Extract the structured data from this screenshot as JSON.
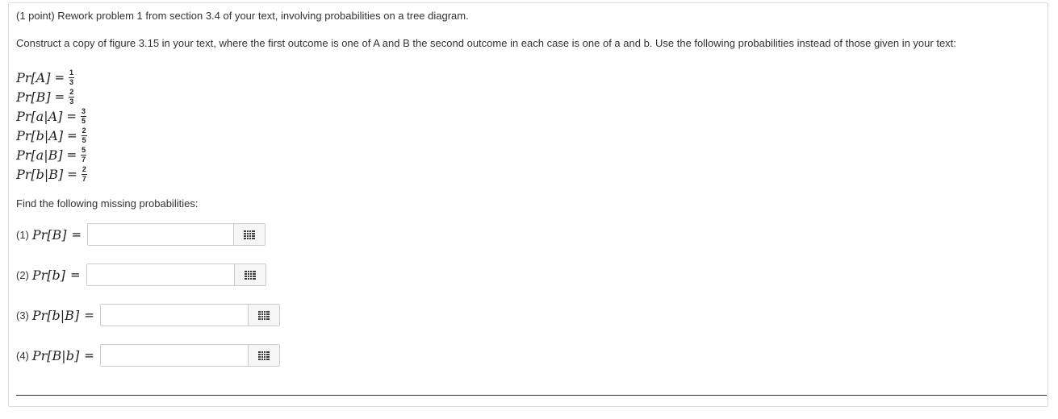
{
  "problem": {
    "header": "(1 point) Rework problem 1 from section 3.4 of your text, involving probabilities on a tree diagram.",
    "instructions": "Construct a copy of figure 3.15 in your text, where the first outcome is one of A and B the second outcome in each case is one of a and b. Use the following probabilities instead of those given in your text:"
  },
  "given": [
    {
      "lhs": "Pr[A]",
      "num": "1",
      "den": "3"
    },
    {
      "lhs": "Pr[B]",
      "num": "2",
      "den": "3"
    },
    {
      "lhs": "Pr[a|A]",
      "num": "3",
      "den": "5"
    },
    {
      "lhs": "Pr[b|A]",
      "num": "2",
      "den": "5"
    },
    {
      "lhs": "Pr[a|B]",
      "num": "5",
      "den": "7"
    },
    {
      "lhs": "Pr[b|B]",
      "num": "2",
      "den": "7"
    }
  ],
  "find_label": "Find the following missing probabilities:",
  "answers": [
    {
      "label": "(1)",
      "expr": "Pr[B]",
      "value": ""
    },
    {
      "label": "(2)",
      "expr": "Pr[b]",
      "value": ""
    },
    {
      "label": "(3)",
      "expr": "Pr[b|B]",
      "value": ""
    },
    {
      "label": "(4)",
      "expr": "Pr[B|b]",
      "value": ""
    }
  ],
  "equals_sign": "=",
  "icons": {
    "palette": "equation-palette-icon"
  },
  "colors": {
    "border": "#dddddd",
    "text": "#333333",
    "palette_dots": "#3c3c3c"
  }
}
